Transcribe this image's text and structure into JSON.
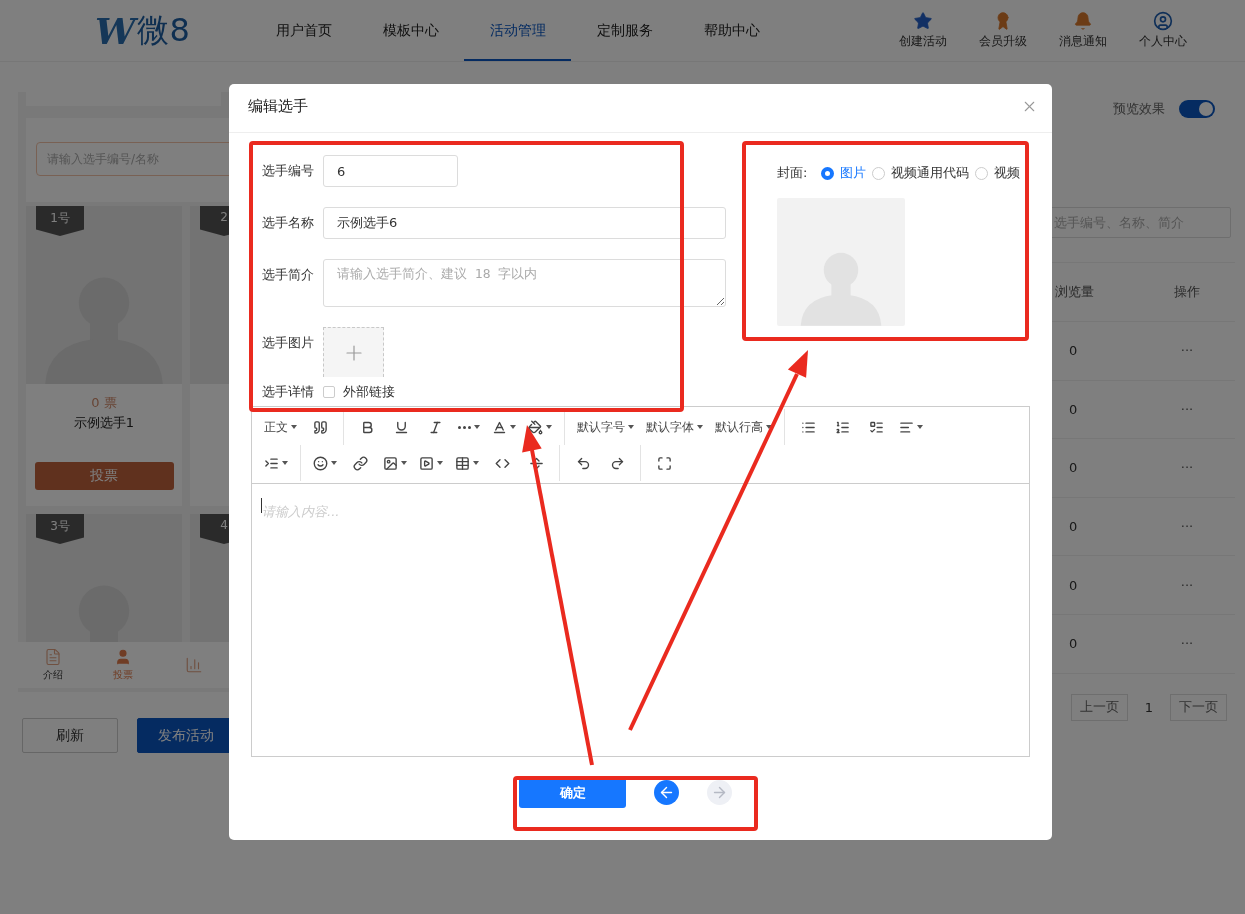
{
  "header": {
    "logo": {
      "mark": "W",
      "text": "微8"
    },
    "nav": [
      {
        "label": "用户首页",
        "selected": false
      },
      {
        "label": "模板中心",
        "selected": false
      },
      {
        "label": "活动管理",
        "selected": true
      },
      {
        "label": "定制服务",
        "selected": false
      },
      {
        "label": "帮助中心",
        "selected": false
      }
    ],
    "actions": [
      {
        "kind": "create",
        "label": "创建活动"
      },
      {
        "kind": "upgrade",
        "label": "会员升级"
      },
      {
        "kind": "notice",
        "label": "消息通知"
      },
      {
        "kind": "profile",
        "label": "个人中心"
      }
    ]
  },
  "preview": {
    "search_placeholder": "请输入选手编号/名称",
    "cards": [
      {
        "badge": "1号",
        "photo": true,
        "votes": "0 票",
        "name": "示例选手1",
        "button": "投票"
      },
      {
        "badge": "2"
      },
      {
        "badge": "3号",
        "photo": true
      },
      {
        "badge": "4"
      }
    ],
    "tabbar": [
      {
        "kind": "intro",
        "label": "介绍",
        "selected": false
      },
      {
        "kind": "vote",
        "label": "投票",
        "selected": true
      },
      {
        "kind": "rank",
        "selected": false
      }
    ],
    "buttons": [
      {
        "kind": "plain",
        "label": "刷新"
      },
      {
        "kind": "primary",
        "label": "发布活动"
      }
    ]
  },
  "manager": {
    "preview_toggle": {
      "label": "预览效果",
      "on": true
    },
    "search_placeholder": "选手编号、名称、简介",
    "columns": [
      "浏览量",
      "操作"
    ],
    "rows": [
      {
        "views": "0",
        "action": "···"
      },
      {
        "views": "0",
        "action": "···"
      },
      {
        "views": "0",
        "action": "···"
      },
      {
        "views": "0",
        "action": "···"
      },
      {
        "views": "0",
        "action": "···"
      },
      {
        "views": "0",
        "action": "···"
      }
    ],
    "pagination": {
      "prev": "上一页",
      "page": "1",
      "next": "下一页"
    }
  },
  "dialog": {
    "title": "编辑选手",
    "fields": [
      {
        "kind": "input",
        "label": "选手编号",
        "value": "6"
      },
      {
        "kind": "wide-input",
        "label": "选手名称",
        "value": "示例选手6"
      },
      {
        "kind": "textarea",
        "label": "选手简介",
        "placeholder": "请输入选手简介、建议 18 字以内"
      },
      {
        "kind": "upload",
        "label": "选手图片"
      },
      {
        "kind": "checkbox",
        "label": "选手详情",
        "option": "外部链接",
        "checked": false
      }
    ],
    "cover": {
      "label": "封面:",
      "options": [
        {
          "label": "图片",
          "selected": true
        },
        {
          "label": "视频通用代码",
          "selected": false
        },
        {
          "label": "视频",
          "selected": false
        }
      ]
    },
    "editor": {
      "toolbar": [
        [
          [
            {
              "kind": "select",
              "label": "正文",
              "dropdown": true
            },
            {
              "kind": "quote",
              "dropdown": false
            }
          ],
          [
            {
              "kind": "bold",
              "dropdown": false
            },
            {
              "kind": "underline",
              "dropdown": false
            },
            {
              "kind": "italic",
              "dropdown": false
            },
            {
              "kind": "more",
              "dropdown": true
            },
            {
              "kind": "font-color",
              "dropdown": true
            },
            {
              "kind": "background-color",
              "dropdown": true
            }
          ],
          [
            {
              "kind": "select",
              "label": "默认字号",
              "dropdown": true
            },
            {
              "kind": "select",
              "label": "默认字体",
              "dropdown": true
            },
            {
              "kind": "select",
              "label": "默认行高",
              "dropdown": true
            }
          ],
          [
            {
              "kind": "bullet-list",
              "dropdown": false
            },
            {
              "kind": "numbered-list",
              "dropdown": false
            },
            {
              "kind": "todo",
              "dropdown": false
            },
            {
              "kind": "align",
              "dropdown": true
            }
          ]
        ],
        [
          [
            {
              "kind": "indent",
              "dropdown": true
            }
          ],
          [
            {
              "kind": "emoji",
              "dropdown": true
            },
            {
              "kind": "link",
              "dropdown": false
            },
            {
              "kind": "image",
              "dropdown": true
            },
            {
              "kind": "video",
              "dropdown": true
            },
            {
              "kind": "table",
              "dropdown": true
            },
            {
              "kind": "code",
              "dropdown": false
            },
            {
              "kind": "divider-line",
              "dropdown": false
            }
          ],
          [
            {
              "kind": "undo",
              "dropdown": false
            },
            {
              "kind": "redo",
              "dropdown": false
            }
          ],
          [
            {
              "kind": "fullscreen",
              "dropdown": false
            }
          ]
        ]
      ],
      "placeholder": "请输入内容..."
    },
    "footer": {
      "confirm": "确定",
      "prev": {
        "disabled": false
      },
      "next": {
        "disabled": true
      }
    }
  },
  "annotations": [
    {
      "kind": "frame"
    },
    {
      "kind": "frame"
    },
    {
      "kind": "frame"
    },
    {
      "kind": "arrow"
    },
    {
      "kind": "arrow"
    }
  ]
}
